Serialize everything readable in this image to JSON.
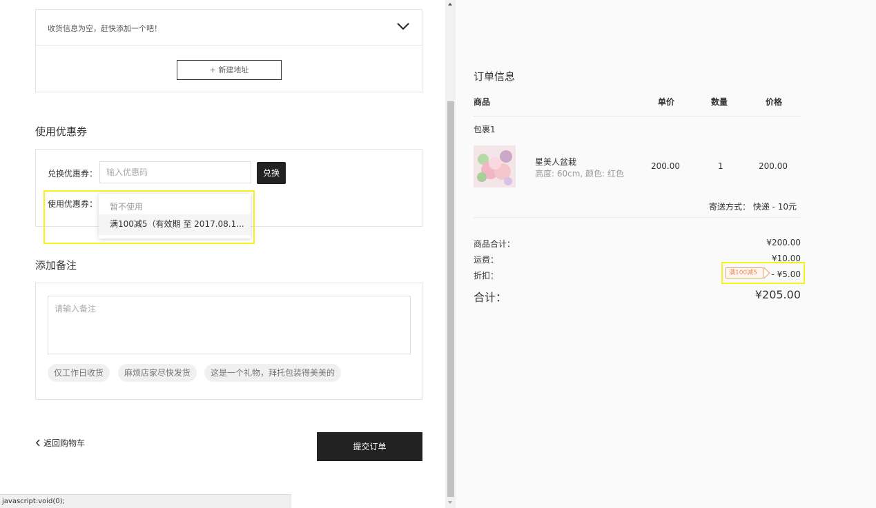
{
  "address": {
    "empty_text": "收货信息为空，赶快添加一个吧！",
    "new_button": "+ 新建地址"
  },
  "coupon": {
    "section_title": "使用优惠券",
    "redeem_label": "兑换优惠券：",
    "redeem_placeholder": "输入优惠码",
    "redeem_button": "兑换",
    "use_label": "使用优惠券：",
    "options": [
      "暂不使用",
      "满100减5（有效期 至 2017.08.1..."
    ]
  },
  "note": {
    "section_title": "添加备注",
    "placeholder": "请输入备注",
    "chips": [
      "仅工作日收货",
      "麻烦店家尽快发货",
      "这是一个礼物，拜托包装得美美的"
    ]
  },
  "footer": {
    "back_link": "返回购物车",
    "submit_button": "提交订单",
    "status_text": "javascript:void(0);"
  },
  "order": {
    "title": "订单信息",
    "headers": {
      "product": "商品",
      "unit_price": "单价",
      "qty": "数量",
      "price": "价格"
    },
    "package_label": "包裹1",
    "item": {
      "name": "星美人盆栽",
      "spec": "高度: 60cm, 颜色: 红色",
      "unit_price": "200.00",
      "qty": "1",
      "price": "200.00"
    },
    "shipping_text": "寄送方式： 快递 - 10元",
    "summary": {
      "subtotal_label": "商品合计：",
      "subtotal_value": "¥200.00",
      "freight_label": "运费：",
      "freight_value": "¥10.00",
      "discount_label": "折扣：",
      "discount_tag": "满100减5",
      "discount_value": "- ¥5.00",
      "total_label": "合计：",
      "total_value": "¥205.00"
    }
  },
  "colors": {
    "highlight": "#f5f31a",
    "dark_button": "#222222",
    "tag_orange": "#e8875a"
  }
}
